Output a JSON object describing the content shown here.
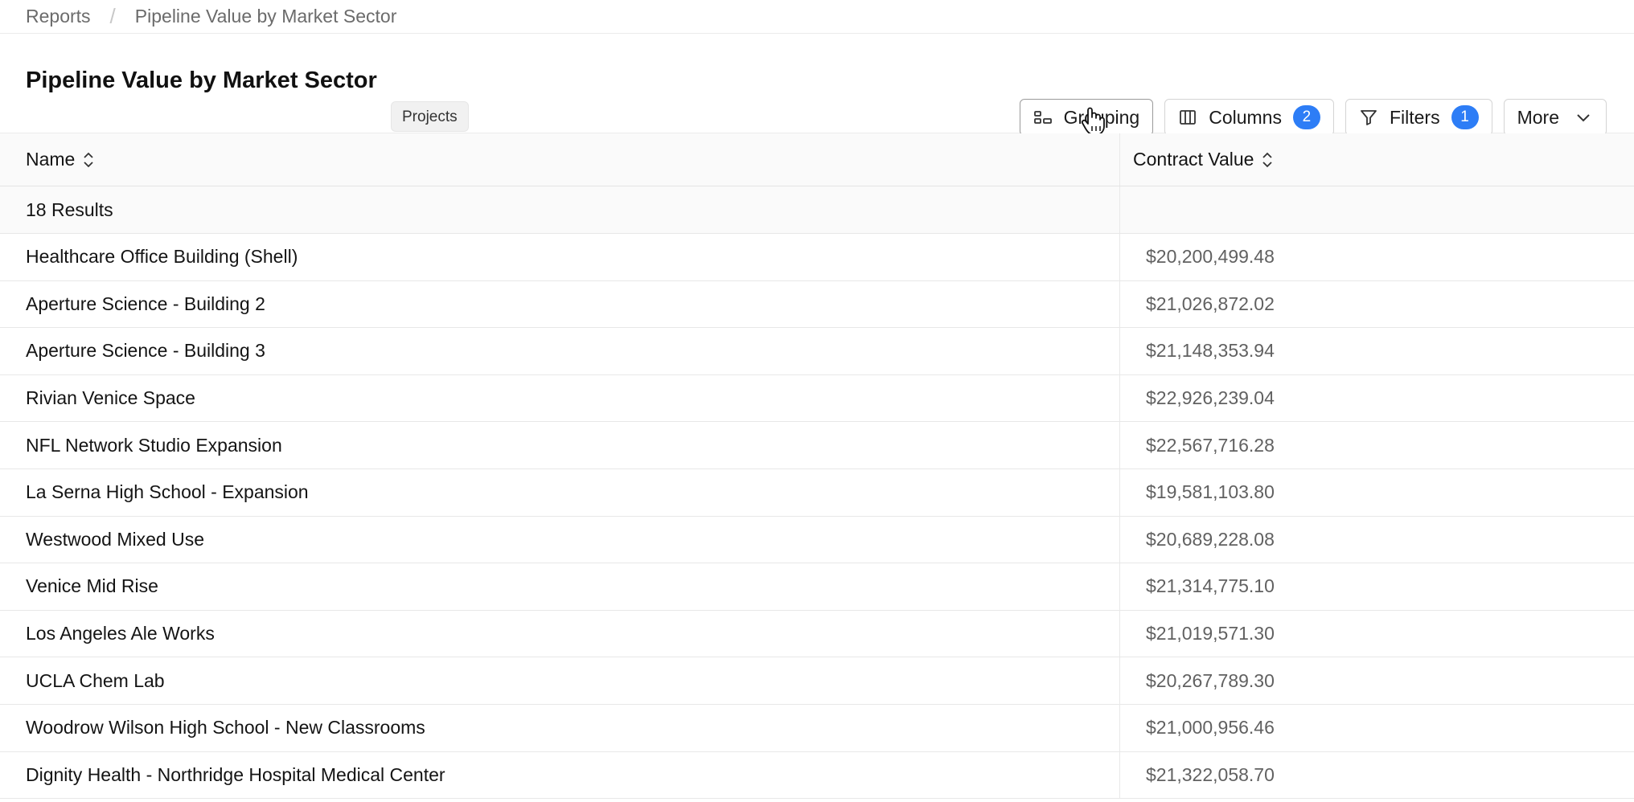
{
  "breadcrumb": {
    "root": "Reports",
    "separator": "/",
    "current": "Pipeline Value by Market Sector"
  },
  "header": {
    "title": "Pipeline Value by Market Sector",
    "tag": "Projects"
  },
  "toolbar": {
    "grouping_label": "Grouping",
    "columns_label": "Columns",
    "columns_count": "2",
    "filters_label": "Filters",
    "filters_count": "1",
    "more_label": "More"
  },
  "table": {
    "columns": [
      "Name",
      "Contract Value"
    ],
    "results_label": "18 Results",
    "rows": [
      {
        "name": "Healthcare Office Building (Shell)",
        "value": "$20,200,499.48"
      },
      {
        "name": "Aperture Science - Building 2",
        "value": "$21,026,872.02"
      },
      {
        "name": "Aperture Science - Building 3",
        "value": "$21,148,353.94"
      },
      {
        "name": "Rivian Venice Space",
        "value": "$22,926,239.04"
      },
      {
        "name": "NFL Network Studio Expansion",
        "value": "$22,567,716.28"
      },
      {
        "name": "La Serna High School - Expansion",
        "value": "$19,581,103.80"
      },
      {
        "name": "Westwood Mixed Use",
        "value": "$20,689,228.08"
      },
      {
        "name": "Venice Mid Rise",
        "value": "$21,314,775.10"
      },
      {
        "name": "Los Angeles Ale Works",
        "value": "$21,019,571.30"
      },
      {
        "name": "UCLA Chem Lab",
        "value": "$20,267,789.30"
      },
      {
        "name": "Woodrow Wilson High School - New Classrooms",
        "value": "$21,000,956.46"
      },
      {
        "name": "Dignity Health - Northridge Hospital Medical Center",
        "value": "$21,322,058.70"
      }
    ]
  },
  "colors": {
    "badge": "#2d7df6",
    "border": "#e8e8e8",
    "header_bg": "#fafafa"
  },
  "icons": {
    "grouping": "grouping-icon",
    "columns": "columns-icon",
    "filters": "filter-icon",
    "more": "chevron-down-icon",
    "sort": "sort-icon",
    "cursor": "hand-cursor-icon"
  }
}
